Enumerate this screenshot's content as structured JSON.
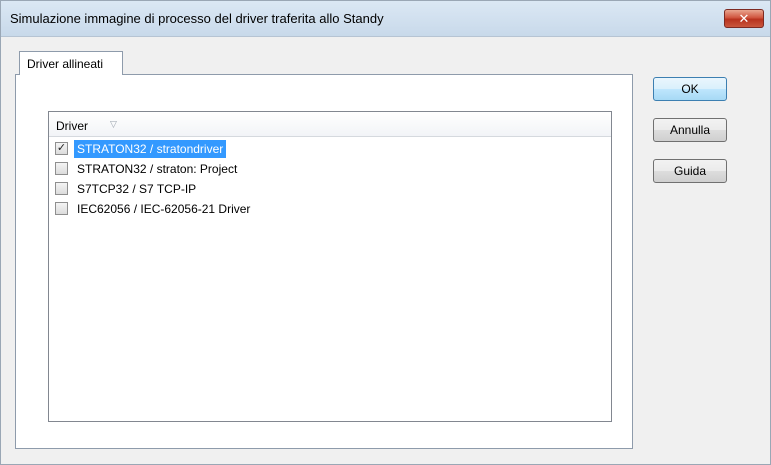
{
  "window": {
    "title": "Simulazione immagine di processo del driver traferita allo Standy",
    "close_symbol": "✕"
  },
  "tabs": [
    {
      "label": "Driver allineati",
      "active": true
    }
  ],
  "list": {
    "column_header": "Driver",
    "sort_icon": "sort-descending-icon",
    "sort_glyph": "▽",
    "rows": [
      {
        "label": "STRATON32 / stratondriver",
        "checked": true,
        "selected": true,
        "check_glyph": "✓"
      },
      {
        "label": "STRATON32 / straton: Project",
        "checked": false,
        "selected": false,
        "check_glyph": ""
      },
      {
        "label": "S7TCP32 / S7 TCP-IP",
        "checked": false,
        "selected": false,
        "check_glyph": ""
      },
      {
        "label": "IEC62056 / IEC-62056-21 Driver",
        "checked": false,
        "selected": false,
        "check_glyph": ""
      }
    ]
  },
  "buttons": {
    "ok": "OK",
    "cancel": "Annulla",
    "help": "Guida"
  },
  "colors": {
    "selection": "#3399ff",
    "close_button": "#c9452f",
    "default_button_border": "#3c7fb1"
  }
}
